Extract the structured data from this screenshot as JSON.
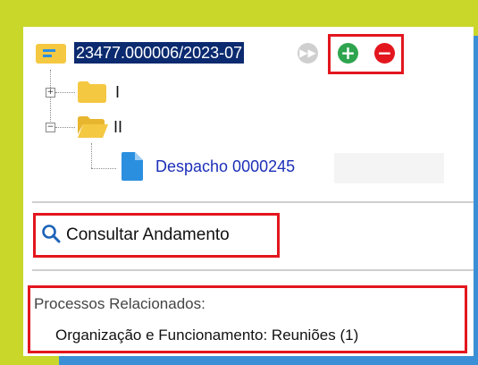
{
  "tree": {
    "process_number": "23477.000006/2023-07",
    "folders": [
      {
        "label": "I",
        "expander": "+"
      },
      {
        "label": "II",
        "expander": "−"
      }
    ],
    "document": {
      "label": "Despacho 0000245"
    }
  },
  "actions": {
    "forward_icon": "fast-forward-icon",
    "add_icon": "plus-circle-icon",
    "remove_icon": "minus-circle-icon",
    "add_symbol": "+",
    "remove_symbol": "−"
  },
  "consult": {
    "label": "Consultar Andamento"
  },
  "related": {
    "title": "Processos Relacionados:",
    "items": [
      "Organização e Funcionamento: Reuniões (1)"
    ]
  },
  "colors": {
    "highlight": "#0b2a6f",
    "link": "#1c2fb8",
    "annotation_box": "#e3161e",
    "add": "#2ea44f",
    "remove": "#e3161e",
    "folder": "#f5c842",
    "document": "#2b8fe0",
    "background": "#c9d72a"
  }
}
